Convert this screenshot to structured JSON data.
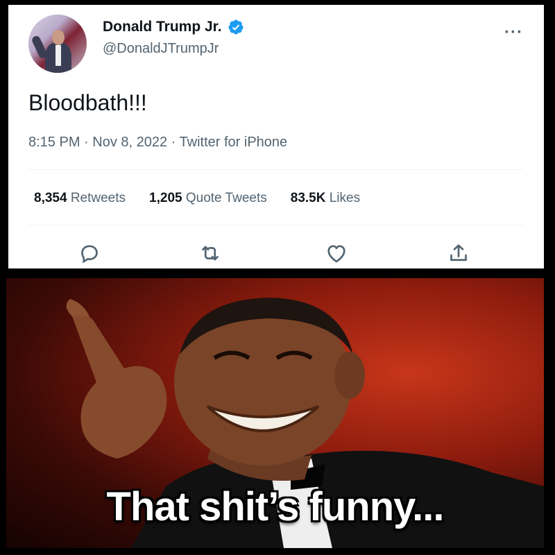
{
  "tweet": {
    "display_name": "Donald Trump Jr.",
    "handle": "@DonaldJTrumpJr",
    "text": "Bloodbath!!!",
    "meta": "8:15 PM · Nov 8, 2022 · Twitter for iPhone",
    "stats": {
      "retweets_count": "8,354",
      "retweets_label": "Retweets",
      "quotes_count": "1,205",
      "quotes_label": "Quote Tweets",
      "likes_count": "83.5K",
      "likes_label": "Likes"
    },
    "more_label": "···",
    "icons": [
      "verified-icon",
      "more-icon",
      "reply-icon",
      "retweet-icon",
      "like-icon",
      "share-icon"
    ],
    "accent_color": "#1d9bf0"
  },
  "meme": {
    "caption": "That shit’s funny..."
  }
}
